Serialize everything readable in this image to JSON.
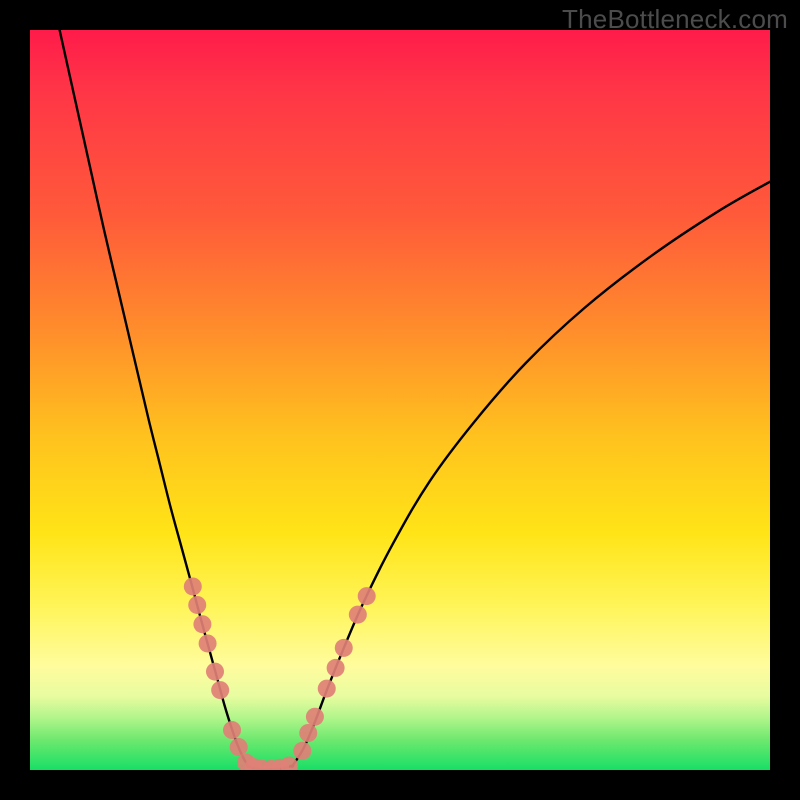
{
  "watermark": "TheBottleneck.com",
  "chart_data": {
    "type": "line",
    "title": "",
    "xlabel": "",
    "ylabel": "",
    "xlim": [
      0,
      100
    ],
    "ylim": [
      0,
      100
    ],
    "grid": false,
    "series": [
      {
        "name": "left-branch",
        "style": "solid",
        "color": "#000000",
        "x": [
          4,
          6,
          8,
          10,
          12,
          14,
          16,
          17.5,
          19,
          20.5,
          22,
          23.2,
          24.3,
          25.4,
          26.3,
          27.2,
          28,
          28.8,
          29.5
        ],
        "y": [
          100,
          91,
          82,
          73,
          64.5,
          56,
          47.5,
          41.5,
          35.5,
          30,
          24.5,
          20,
          16,
          12,
          8.7,
          5.8,
          3.5,
          1.7,
          0.5
        ]
      },
      {
        "name": "valley-floor",
        "style": "solid",
        "color": "#000000",
        "x": [
          29.5,
          31,
          32.5,
          34,
          35.5
        ],
        "y": [
          0.5,
          0.1,
          0.1,
          0.2,
          0.6
        ]
      },
      {
        "name": "right-branch",
        "style": "solid",
        "color": "#000000",
        "x": [
          35.5,
          37,
          38.5,
          40,
          42,
          45,
          49,
          54,
          60,
          67,
          75,
          84,
          93,
          100
        ],
        "y": [
          0.6,
          3,
          6.5,
          10.5,
          15.5,
          22.5,
          30.5,
          39,
          47,
          55,
          62.5,
          69.5,
          75.5,
          79.5
        ]
      }
    ],
    "dot_series": [
      {
        "name": "dots-lower-left",
        "color": "#e08076",
        "x": [
          22.0,
          22.6,
          23.3,
          24.0,
          25.0,
          25.7,
          27.3,
          28.2
        ],
        "y": [
          24.8,
          22.3,
          19.7,
          17.1,
          13.3,
          10.8,
          5.4,
          3.1
        ]
      },
      {
        "name": "dots-floor",
        "color": "#e08076",
        "x": [
          29.2,
          30.2,
          31.4,
          32.6,
          33.8,
          35.0
        ],
        "y": [
          1.0,
          0.4,
          0.15,
          0.15,
          0.3,
          0.6
        ]
      },
      {
        "name": "dots-lower-right",
        "color": "#e08076",
        "x": [
          36.8,
          37.6,
          38.5,
          40.1,
          41.3,
          42.4,
          44.3,
          45.5
        ],
        "y": [
          2.6,
          5.0,
          7.2,
          11.0,
          13.8,
          16.5,
          21.0,
          23.5
        ]
      }
    ]
  }
}
